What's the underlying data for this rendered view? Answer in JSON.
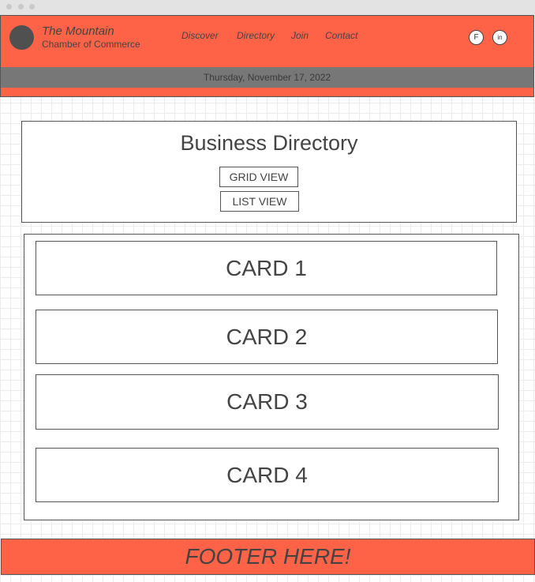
{
  "header": {
    "brand_line1": "The Mountain",
    "brand_line2": "Chamber of Commerce",
    "nav": [
      "Discover",
      "Directory",
      "Join",
      "Contact"
    ],
    "social": [
      "F",
      "in"
    ],
    "date": "Thursday, November 17, 2022"
  },
  "directory": {
    "title": "Business Directory",
    "grid_view_label": "GRID VIEW",
    "list_view_label": "LIST VIEW"
  },
  "cards": [
    "CARD 1",
    "CARD 2",
    "CARD 3",
    "CARD 4"
  ],
  "footer": {
    "text": "FOOTER HERE!"
  },
  "colors": {
    "accent": "#ff6347",
    "date_bar": "#777777",
    "logo": "#505050"
  }
}
